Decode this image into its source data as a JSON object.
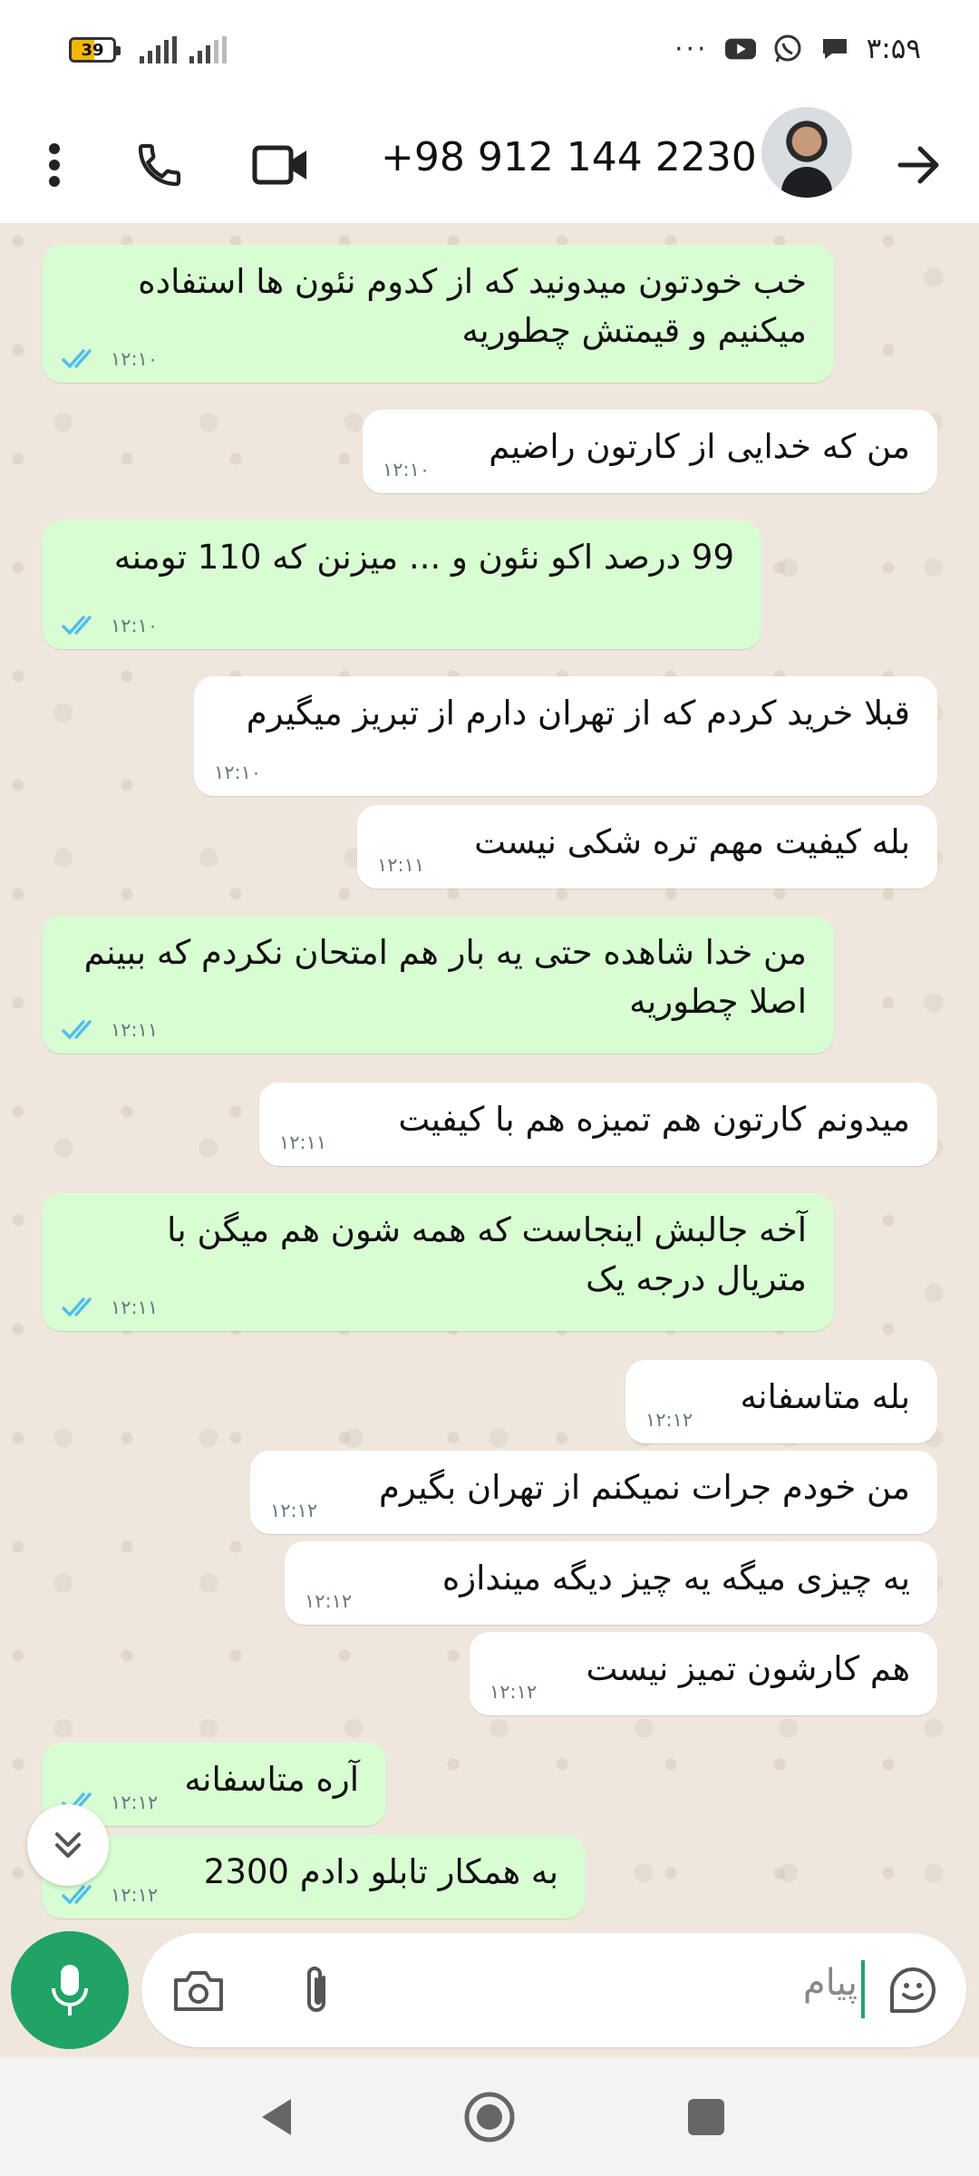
{
  "status_bar": {
    "battery": "39",
    "dots": "···",
    "time": "۳:۵۹"
  },
  "header": {
    "contact": "+98 912 144 2230"
  },
  "messages": [
    {
      "dir": "out",
      "text": "خب خودتون میدونید که از کدوم نئون ها استفاده میکنیم و قیمتش چطوریه",
      "time": "۱۲:۱۰"
    },
    {
      "dir": "in",
      "text": "من که خدایی از کارتون راضیم",
      "time": "۱۲:۱۰"
    },
    {
      "dir": "out",
      "text": "99 درصد اکو نئون و ... میزنن که 110 تومنه",
      "time": "۱۲:۱۰"
    },
    {
      "dir": "in",
      "text": "قبلا خرید کردم که از تهران دارم از تبریز میگیرم",
      "time": "۱۲:۱۰"
    },
    {
      "dir": "in",
      "text": "بله کیفیت مهم تره شکی نیست",
      "time": "۱۲:۱۱"
    },
    {
      "dir": "out",
      "text": "من خدا شاهده حتی یه بار هم امتحان نکردم که ببینم اصلا چطوریه",
      "time": "۱۲:۱۱"
    },
    {
      "dir": "in",
      "text": "میدونم کارتون هم تمیزه هم با کیفیت",
      "time": "۱۲:۱۱"
    },
    {
      "dir": "out",
      "text": "آخه جالبش اینجاست که همه شون هم میگن با متریال درجه یک",
      "time": "۱۲:۱۱"
    },
    {
      "dir": "in",
      "text": "بله متاسفانه",
      "time": "۱۲:۱۲"
    },
    {
      "dir": "in",
      "text": "من خودم جرات نمیکنم از تهران بگیرم",
      "time": "۱۲:۱۲"
    },
    {
      "dir": "in",
      "text": "یه چیزی میگه یه چیز دیگه میندازه",
      "time": "۱۲:۱۲"
    },
    {
      "dir": "in",
      "text": "هم کارشون تمیز نیست",
      "time": "۱۲:۱۲"
    },
    {
      "dir": "out",
      "text": "آره متاسفانه",
      "time": "۱۲:۱۲"
    },
    {
      "dir": "out",
      "text": "به همکار تابلو دادم 2300",
      "time": "۱۲:۱۲"
    }
  ],
  "input": {
    "placeholder": "پیام"
  },
  "colors": {
    "outgoing_bubble": "#d9fdd3",
    "incoming_bubble": "#ffffff",
    "accent_green": "#21a366",
    "read_ticks": "#53bdeb",
    "chat_background": "#efe7dd"
  },
  "icons": [
    "battery-icon",
    "signal-icon",
    "youtube-icon",
    "whatsapp-icon",
    "chat-icon",
    "more-icon",
    "phone-icon",
    "video-icon",
    "avatar",
    "forward-arrow-icon",
    "mic-icon",
    "camera-icon",
    "attach-icon",
    "sticker-icon",
    "scroll-down-icon",
    "back-icon",
    "home-icon",
    "recents-icon"
  ]
}
